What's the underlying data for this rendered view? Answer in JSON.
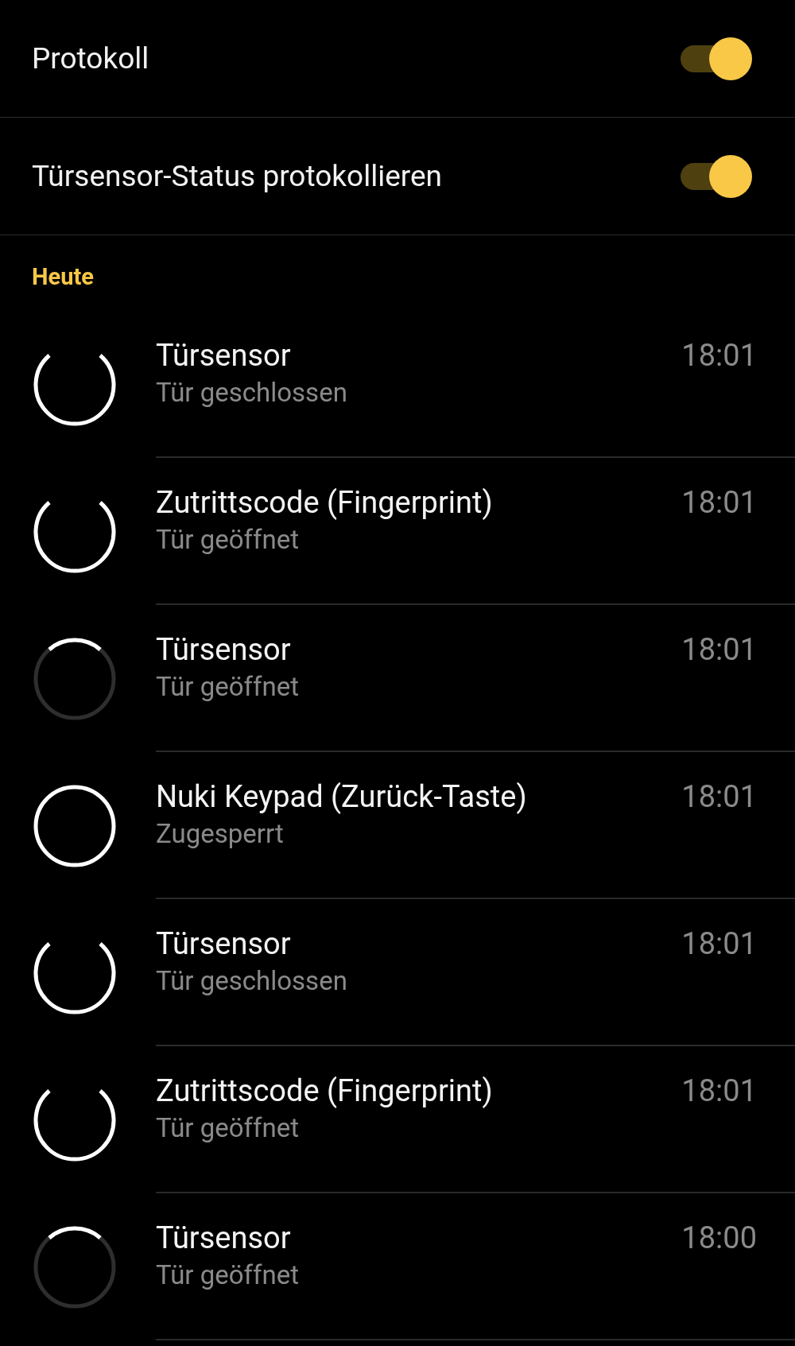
{
  "settings": [
    {
      "label": "Protokoll",
      "on": true
    },
    {
      "label": "Türsensor-Status protokollieren",
      "on": true
    }
  ],
  "section": "Heute",
  "entries": [
    {
      "kind": "gap",
      "title": "Türsensor",
      "subtitle": "Tür geschlossen",
      "time": "18:01"
    },
    {
      "kind": "gap",
      "title": "Zutrittscode (Fingerprint)",
      "subtitle": "Tür geöffnet",
      "time": "18:01"
    },
    {
      "kind": "arc",
      "title": "Türsensor",
      "subtitle": "Tür geöffnet",
      "time": "18:01"
    },
    {
      "kind": "full",
      "title": "Nuki Keypad (Zurück-Taste)",
      "subtitle": "Zugesperrt",
      "time": "18:01"
    },
    {
      "kind": "gap",
      "title": "Türsensor",
      "subtitle": "Tür geschlossen",
      "time": "18:01"
    },
    {
      "kind": "gap",
      "title": "Zutrittscode (Fingerprint)",
      "subtitle": "Tür geöffnet",
      "time": "18:01"
    },
    {
      "kind": "arc",
      "title": "Türsensor",
      "subtitle": "Tür geöffnet",
      "time": "18:00"
    }
  ]
}
